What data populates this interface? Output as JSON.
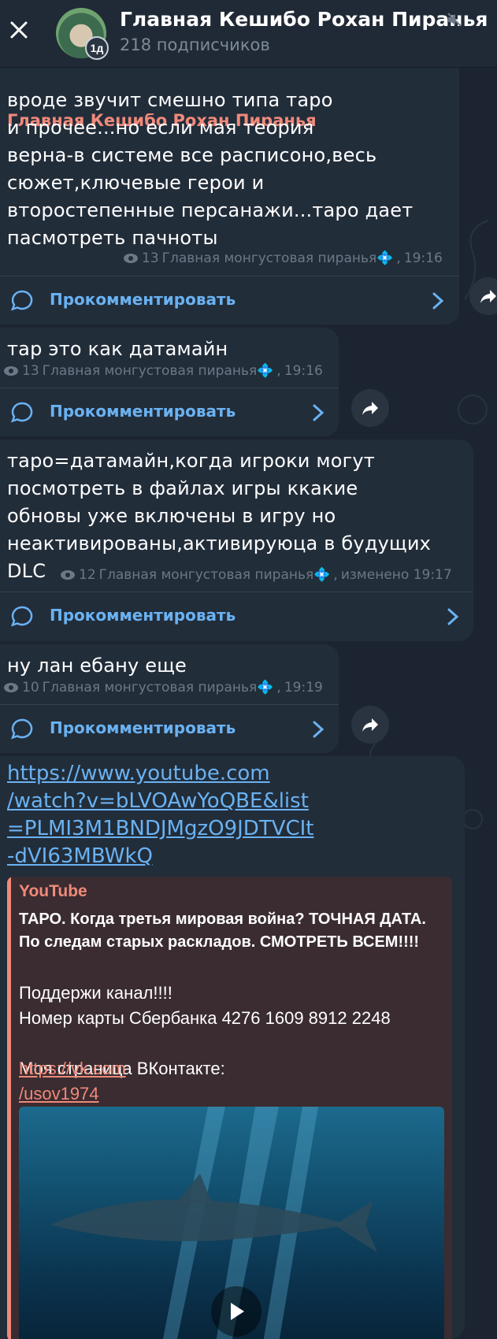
{
  "header": {
    "title": "Главная Кешибо Рохан Пиранья",
    "subtitle": "218 подписчиков",
    "avatar_badge": "1д"
  },
  "comment_label": "Прокомментировать",
  "messages": [
    {
      "sender": "Главная Кешибо Рохан Пиранья",
      "text": "вроде звучит смешно типа таро\nи прочее...но если мая теория\nверна-в системе все расписоно,весь\nсюжет,ключевые герои и\nвторостепенные персанажи...таро дает\nпасмотреть пачноты",
      "views": "13",
      "author": "Главная монгустовая пиранья💠",
      "time": "19:16"
    },
    {
      "text": "тар это как датамайн",
      "views": "13",
      "author": "Главная монгустовая пиранья💠",
      "time": "19:16"
    },
    {
      "text": "таро=датамайн,когда игроки могут\nпосмотреть в файлах игры ккакие\nобновы уже включены в игру но\nнеактивированы,активируюца в будущих\nDLC",
      "views": "12",
      "author": "Главная монгустовая пиранья💠",
      "time": "изменено 19:17"
    },
    {
      "text": "ну лан ебану еще",
      "views": "10",
      "author": "Главная монгустовая пиранья💠",
      "time": "19:19"
    }
  ],
  "link_message": {
    "url": "https://www.youtube.com\n/watch?v=bLVOAwYoQBE&list\n=PLMI3M1BNDJMgzO9JDTVCIt\n-dVI63MBWkQ",
    "preview": {
      "site": "YouTube",
      "title": "ТАРО. Когда третья мировая война? ТОЧНАЯ ДАТА. По следам старых раскладов. СМОТРЕТЬ ВСЕМ!!!!",
      "description": "Поддержи канал!!!!\nНомер карты Сбербанка 4276 1609 8912 2248\n\nМоя страница ВКонтакте: ",
      "description_link": "https://vk.com\n/usov1974"
    }
  },
  "colors": {
    "background": "#1b2430",
    "bubble": "#222d3a",
    "accent": "#6ab2f2",
    "youtube_accent": "#f08a7a"
  },
  "icons": [
    "close-icon",
    "mute-icon",
    "eye-icon",
    "comment-icon",
    "chevron-right-icon",
    "share-icon",
    "play-icon"
  ]
}
